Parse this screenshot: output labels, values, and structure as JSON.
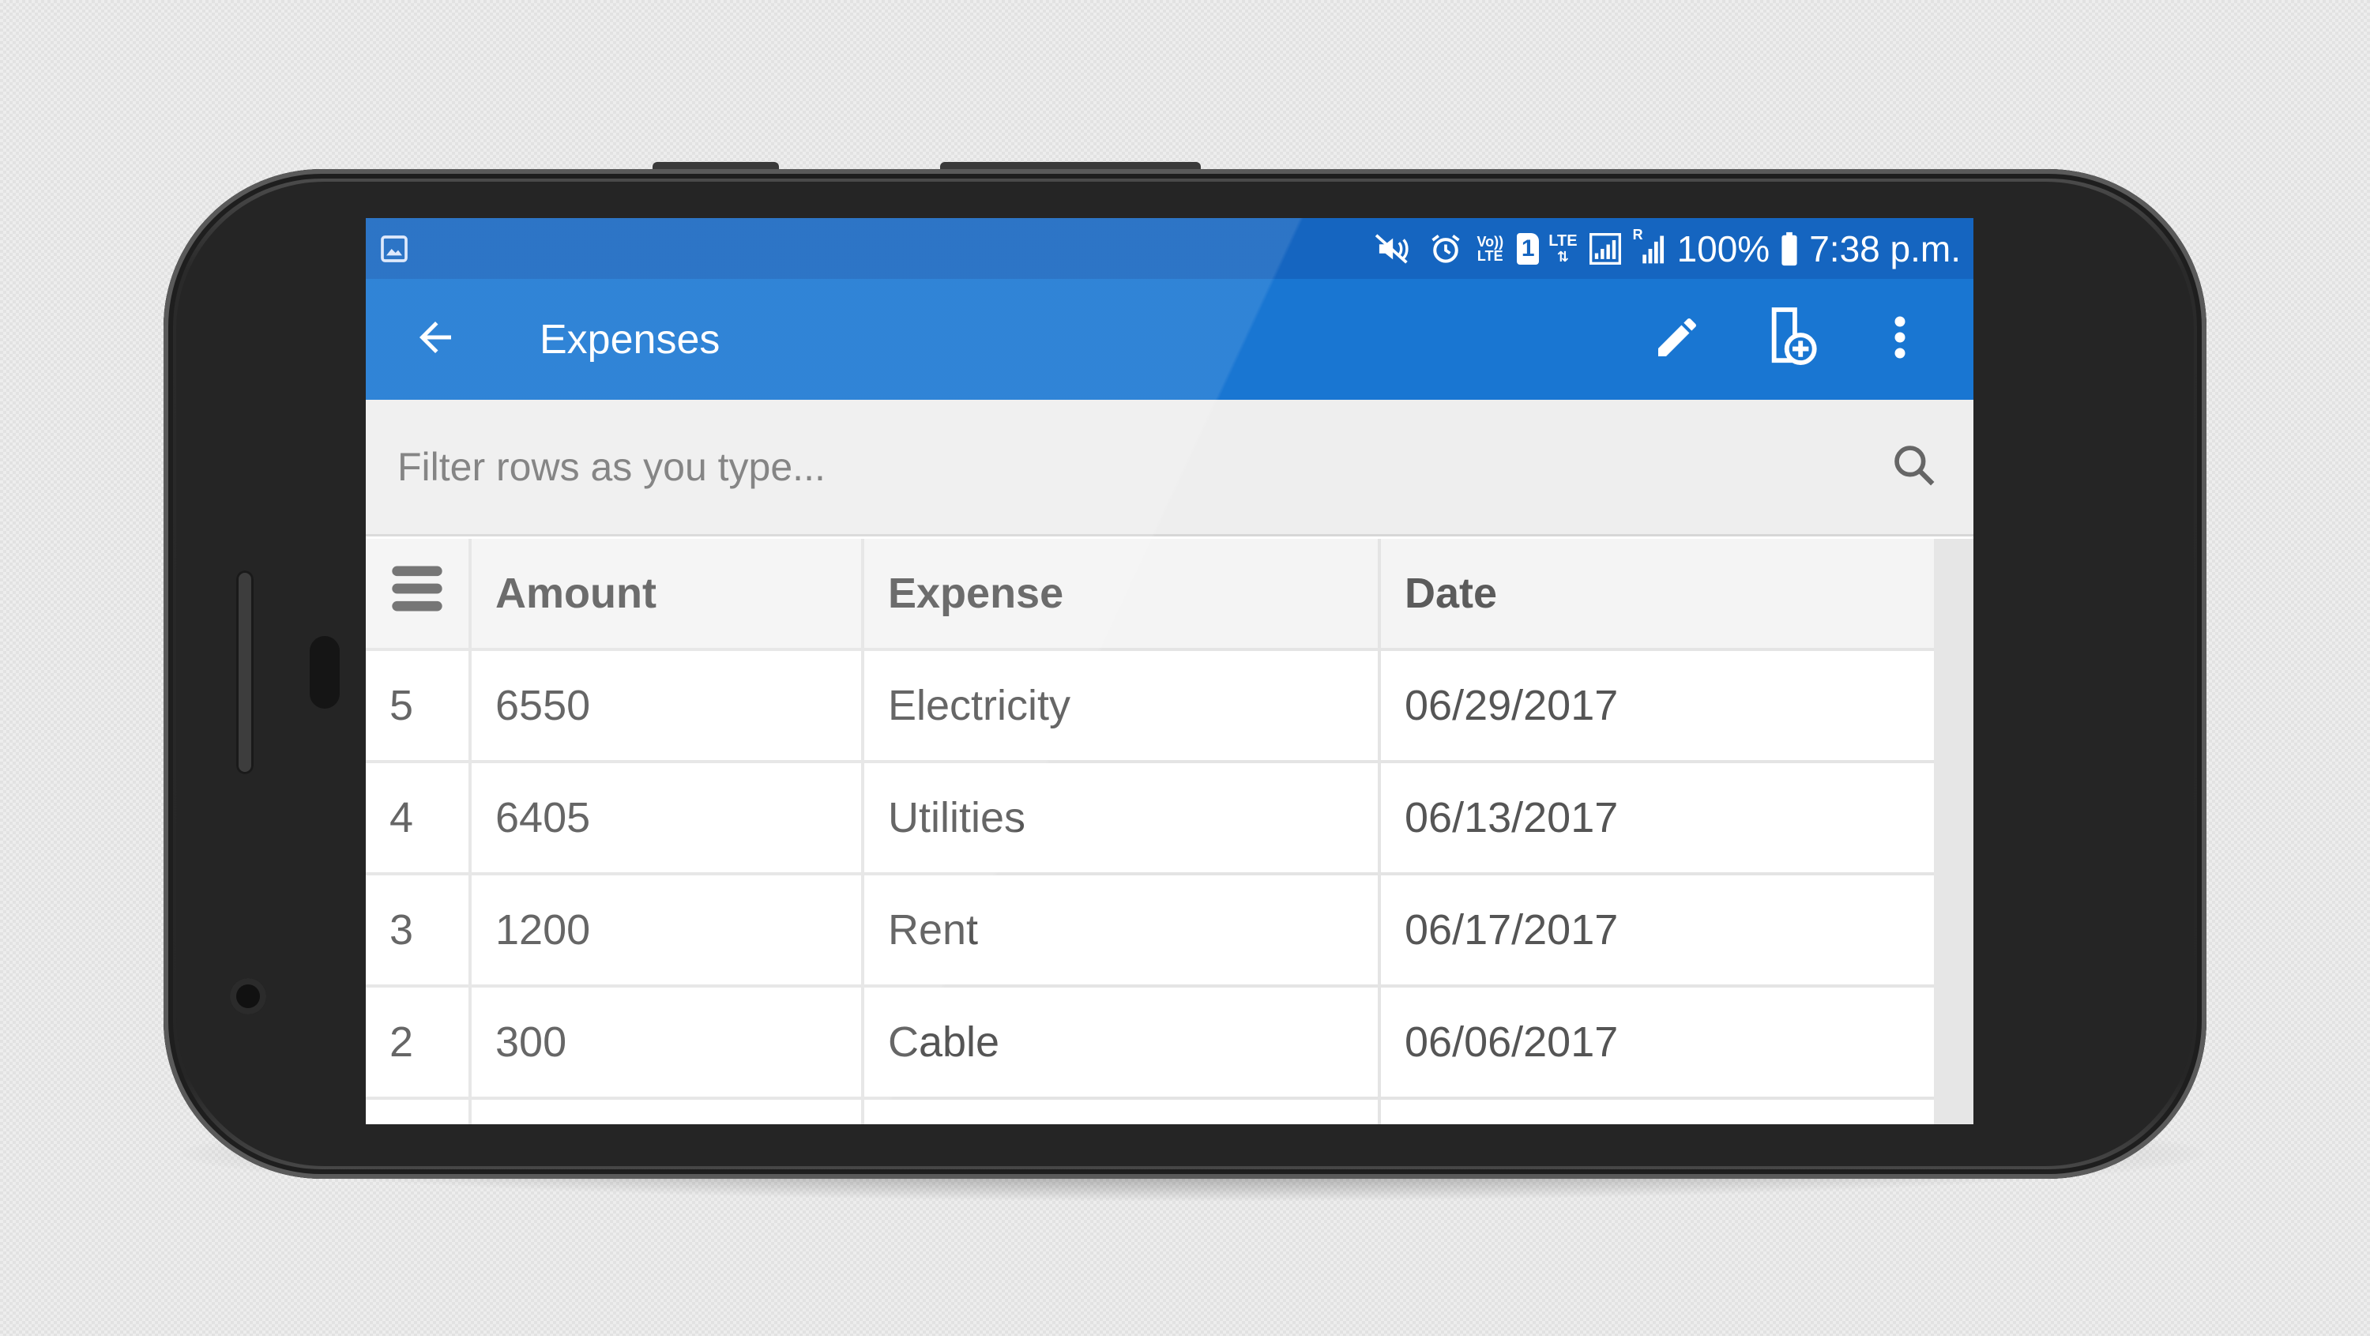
{
  "status_bar": {
    "battery": "100%",
    "time": "7:38 p.m.",
    "sim_label": "1",
    "volte_label": "Vo)) LTE",
    "lte_label": "LTE",
    "roaming_label": "R",
    "icons": [
      "gallery-notification-icon",
      "mute-icon",
      "alarm-icon",
      "volte-icon",
      "sim-icon",
      "lte-icon",
      "signal-roaming-icon",
      "signal-icon",
      "battery-icon"
    ]
  },
  "app_bar": {
    "title": "Expenses",
    "icons": [
      "back-arrow-icon",
      "pencil-icon",
      "add-document-icon",
      "more-vert-icon"
    ]
  },
  "filter": {
    "placeholder": "Filter rows as you type..."
  },
  "table": {
    "columns": [
      "Amount",
      "Expense",
      "Date"
    ],
    "rows": [
      {
        "id": "5",
        "amount": "6550",
        "expense": "Electricity",
        "date": "06/29/2017"
      },
      {
        "id": "4",
        "amount": "6405",
        "expense": "Utilities",
        "date": "06/13/2017"
      },
      {
        "id": "3",
        "amount": "1200",
        "expense": "Rent",
        "date": "06/17/2017"
      },
      {
        "id": "2",
        "amount": "300",
        "expense": "Cable",
        "date": "06/06/2017"
      }
    ]
  },
  "colors": {
    "status_bar": "#1565c0",
    "app_bar": "#1976d2",
    "filter_bg": "#eeeeee",
    "text": "#555555"
  }
}
